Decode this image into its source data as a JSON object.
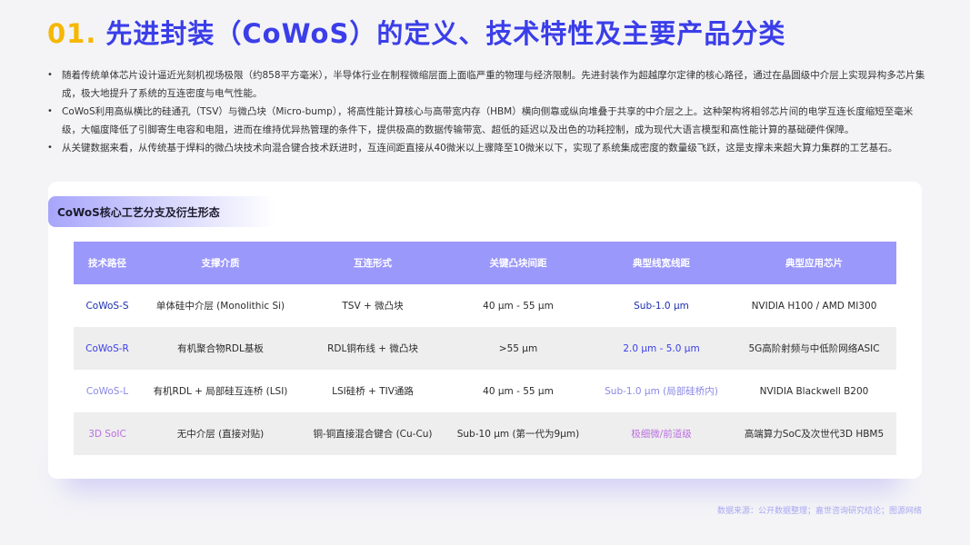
{
  "title": {
    "number": "01.",
    "text": "先进封装（CoWoS）的定义、技术特性及主要产品分类"
  },
  "bullets": [
    "随着传统单体芯片设计逼近光刻机视场极限（约858平方毫米），半导体行业在制程微缩层面上面临严重的物理与经济限制。先进封装作为超越摩尔定律的核心路径，通过在晶圆级中介层上实现异构多芯片集成，极大地提升了系统的互连密度与电气性能。",
    "CoWoS利用高纵横比的硅通孔（TSV）与微凸块（Micro-bump），将高性能计算核心与高带宽内存（HBM）横向侧靠或纵向堆叠于共享的中介层之上。这种架构将相邻芯片间的电学互连长度缩短至毫米级，大幅度降低了引脚寄生电容和电阻，进而在维持优异热管理的条件下，提供极高的数据传输带宽、超低的延迟以及出色的功耗控制，成为现代大语言模型和高性能计算的基础硬件保障。",
    "从关键数据来看，从传统基于焊料的微凸块技术向混合键合技术跃进时，互连间距直接从40微米以上骤降至10微米以下，实现了系统集成密度的数量级飞跃，这是支撑未来超大算力集群的工艺基石。"
  ],
  "card": {
    "tag": "CoWoS核心工艺分支及衍生形态",
    "table": {
      "headers": [
        "技术路径",
        "支撑介质",
        "互连形式",
        "关键凸块间距",
        "典型线宽线距",
        "典型应用芯片"
      ],
      "rows": [
        [
          "CoWoS-S",
          "单体硅中介层 (Monolithic Si)",
          "TSV + 微凸块",
          "40 μm - 55 μm",
          "Sub-1.0 μm",
          "NVIDIA H100 / AMD MI300"
        ],
        [
          "CoWoS-R",
          "有机聚合物RDL基板",
          "RDL铜布线 + 微凸块",
          ">55 μm",
          "2.0 μm - 5.0 μm",
          "5G高阶射频与中低阶网络ASIC"
        ],
        [
          "CoWoS-L",
          "有机RDL + 局部硅互连桥 (LSI)",
          "LSI硅桥 + TIV通路",
          "40 μm - 55 μm",
          "Sub-1.0 μm (局部硅桥内)",
          "NVIDIA Blackwell B200"
        ],
        [
          "3D SoIC",
          "无中介层 (直接对贴)",
          "铜-铜直接混合键合 (Cu-Cu)",
          "Sub-10 μm (第一代为9μm)",
          "极细微/前道级",
          "高端算力SoC及次世代3D HBM5"
        ]
      ]
    }
  },
  "source": "数据来源：公开数据整理；嘉世咨询研究结论；图源网络",
  "colors": {
    "title_number": "#f6b700",
    "title_text": "#3b3ee8",
    "table_header": "#9b98fb",
    "row1_accent": "#1c2fb0",
    "row2_accent": "#3b3ee8",
    "row3_accent": "#8a88e6",
    "row4_accent": "#bb6fe0"
  }
}
